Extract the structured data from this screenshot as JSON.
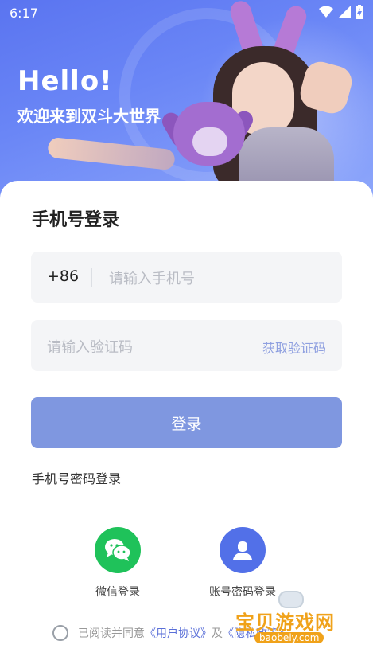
{
  "status_bar": {
    "time": "6:17"
  },
  "hero": {
    "title": "Hello!",
    "subtitle": "欢迎来到双斗大世界"
  },
  "login": {
    "title": "手机号登录",
    "country_code": "+86",
    "phone_placeholder": "请输入手机号",
    "code_placeholder": "请输入验证码",
    "get_code": "获取验证码",
    "submit": "登录",
    "password_login": "手机号密码登录"
  },
  "alt_login": [
    {
      "label": "微信登录",
      "icon": "wechat-icon",
      "color": "#1fc25a"
    },
    {
      "label": "账号密码登录",
      "icon": "user-icon",
      "color": "#5270e8"
    }
  ],
  "agreement": {
    "prefix": "已阅读并同意",
    "user_agreement": "《用户协议》",
    "and": "及",
    "privacy_policy": "《隐私政策》"
  },
  "watermark": {
    "name": "宝贝游戏网",
    "url": "baobeiy.com"
  },
  "colors": {
    "accent": "#7f97e0",
    "link": "#5a6fd8",
    "wechat": "#1fc25a",
    "account": "#5270e8"
  }
}
